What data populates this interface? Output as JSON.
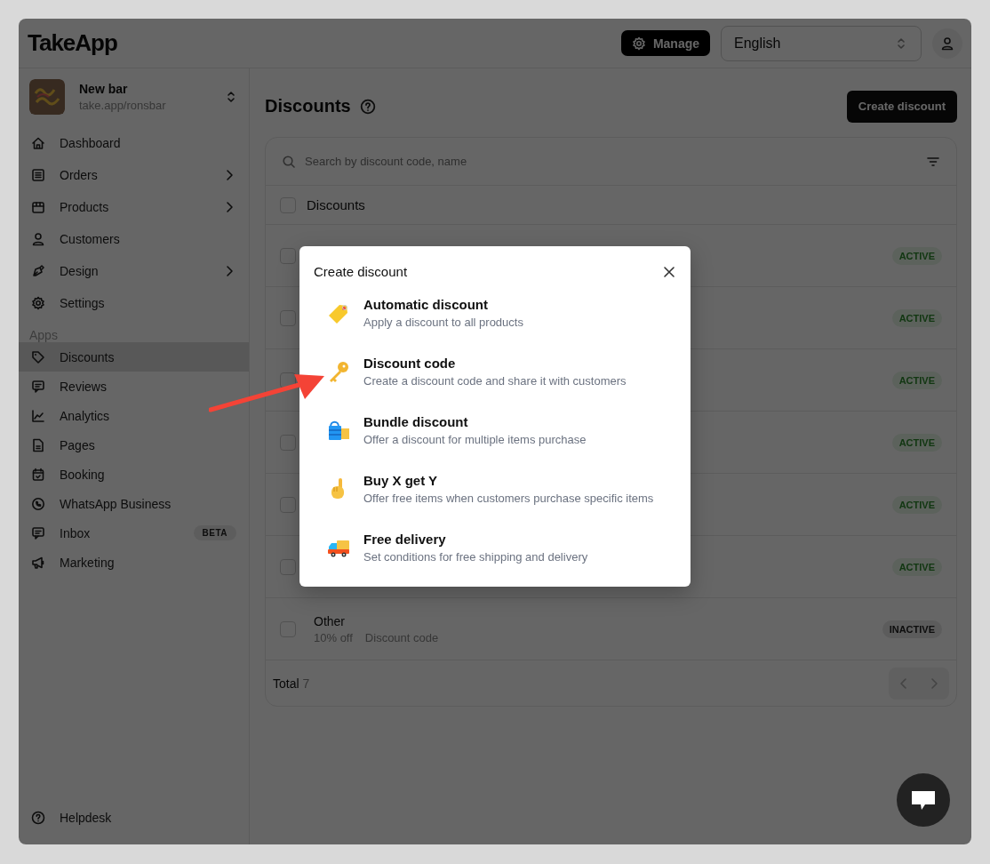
{
  "header": {
    "logo": "TakeApp",
    "manage_button": "Manage",
    "language": "English"
  },
  "store": {
    "name": "New bar",
    "url": "take.app/ronsbar"
  },
  "nav": [
    {
      "label": "Dashboard",
      "has_submenu": false
    },
    {
      "label": "Orders",
      "has_submenu": true
    },
    {
      "label": "Products",
      "has_submenu": true
    },
    {
      "label": "Customers",
      "has_submenu": false
    },
    {
      "label": "Design",
      "has_submenu": true
    },
    {
      "label": "Settings",
      "has_submenu": false
    }
  ],
  "apps_heading": "Apps",
  "apps": [
    {
      "label": "Discounts",
      "selected": true
    },
    {
      "label": "Reviews",
      "selected": false
    },
    {
      "label": "Analytics",
      "selected": false
    },
    {
      "label": "Pages",
      "selected": false
    },
    {
      "label": "Booking",
      "selected": false
    },
    {
      "label": "WhatsApp Business",
      "selected": false
    },
    {
      "label": "Inbox",
      "selected": false,
      "badge": "BETA"
    },
    {
      "label": "Marketing",
      "selected": false
    }
  ],
  "helpdesk": "Helpdesk",
  "page": {
    "title": "Discounts",
    "create_button": "Create discount"
  },
  "search": {
    "placeholder": "Search by discount code, name"
  },
  "table": {
    "header": "Discounts",
    "header_checked": false,
    "rows": [
      {
        "status": "ACTIVE",
        "kind": "active",
        "checked": false
      },
      {
        "status": "ACTIVE",
        "kind": "active",
        "checked": false
      },
      {
        "status": "ACTIVE",
        "kind": "active",
        "checked": false
      },
      {
        "status": "ACTIVE",
        "kind": "active",
        "checked": false
      },
      {
        "status": "ACTIVE",
        "kind": "active",
        "checked": false
      },
      {
        "status": "ACTIVE",
        "kind": "active",
        "checked": false
      },
      {
        "title": "Other",
        "value": "10% off",
        "type": "Discount code",
        "status": "INACTIVE",
        "kind": "inactive",
        "checked": false
      }
    ]
  },
  "footer": {
    "total_label": "Total",
    "total": "7"
  },
  "modal": {
    "title": "Create discount",
    "options": [
      {
        "title": "Automatic discount",
        "description": "Apply a discount to all products"
      },
      {
        "title": "Discount code",
        "description": "Create a discount code and share it with customers"
      },
      {
        "title": "Bundle discount",
        "description": "Offer a discount for multiple items purchase"
      },
      {
        "title": "Buy X get Y",
        "description": "Offer free items when customers purchase specific items"
      },
      {
        "title": "Free delivery",
        "description": "Set conditions for free shipping and delivery"
      }
    ]
  }
}
